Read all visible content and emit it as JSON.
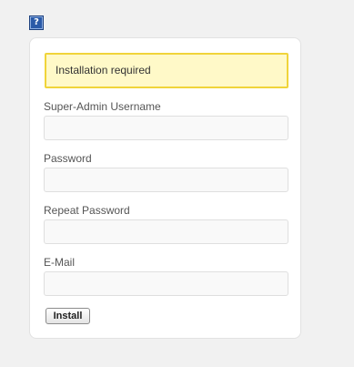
{
  "help": {
    "glyph": "?",
    "icon": "help-icon"
  },
  "notice": {
    "text": "Installation required"
  },
  "form": {
    "fields": [
      {
        "label": "Super-Admin Username",
        "value": "",
        "placeholder": ""
      },
      {
        "label": "Password",
        "value": "",
        "placeholder": ""
      },
      {
        "label": "Repeat Password",
        "value": "",
        "placeholder": ""
      },
      {
        "label": "E-Mail",
        "value": "",
        "placeholder": ""
      }
    ],
    "submit_label": "Install"
  },
  "colors": {
    "page_background": "#f1f1f1",
    "notice_background": "#fff9c8",
    "notice_border": "#f0d43a",
    "help_icon": "#2a5aa8"
  }
}
